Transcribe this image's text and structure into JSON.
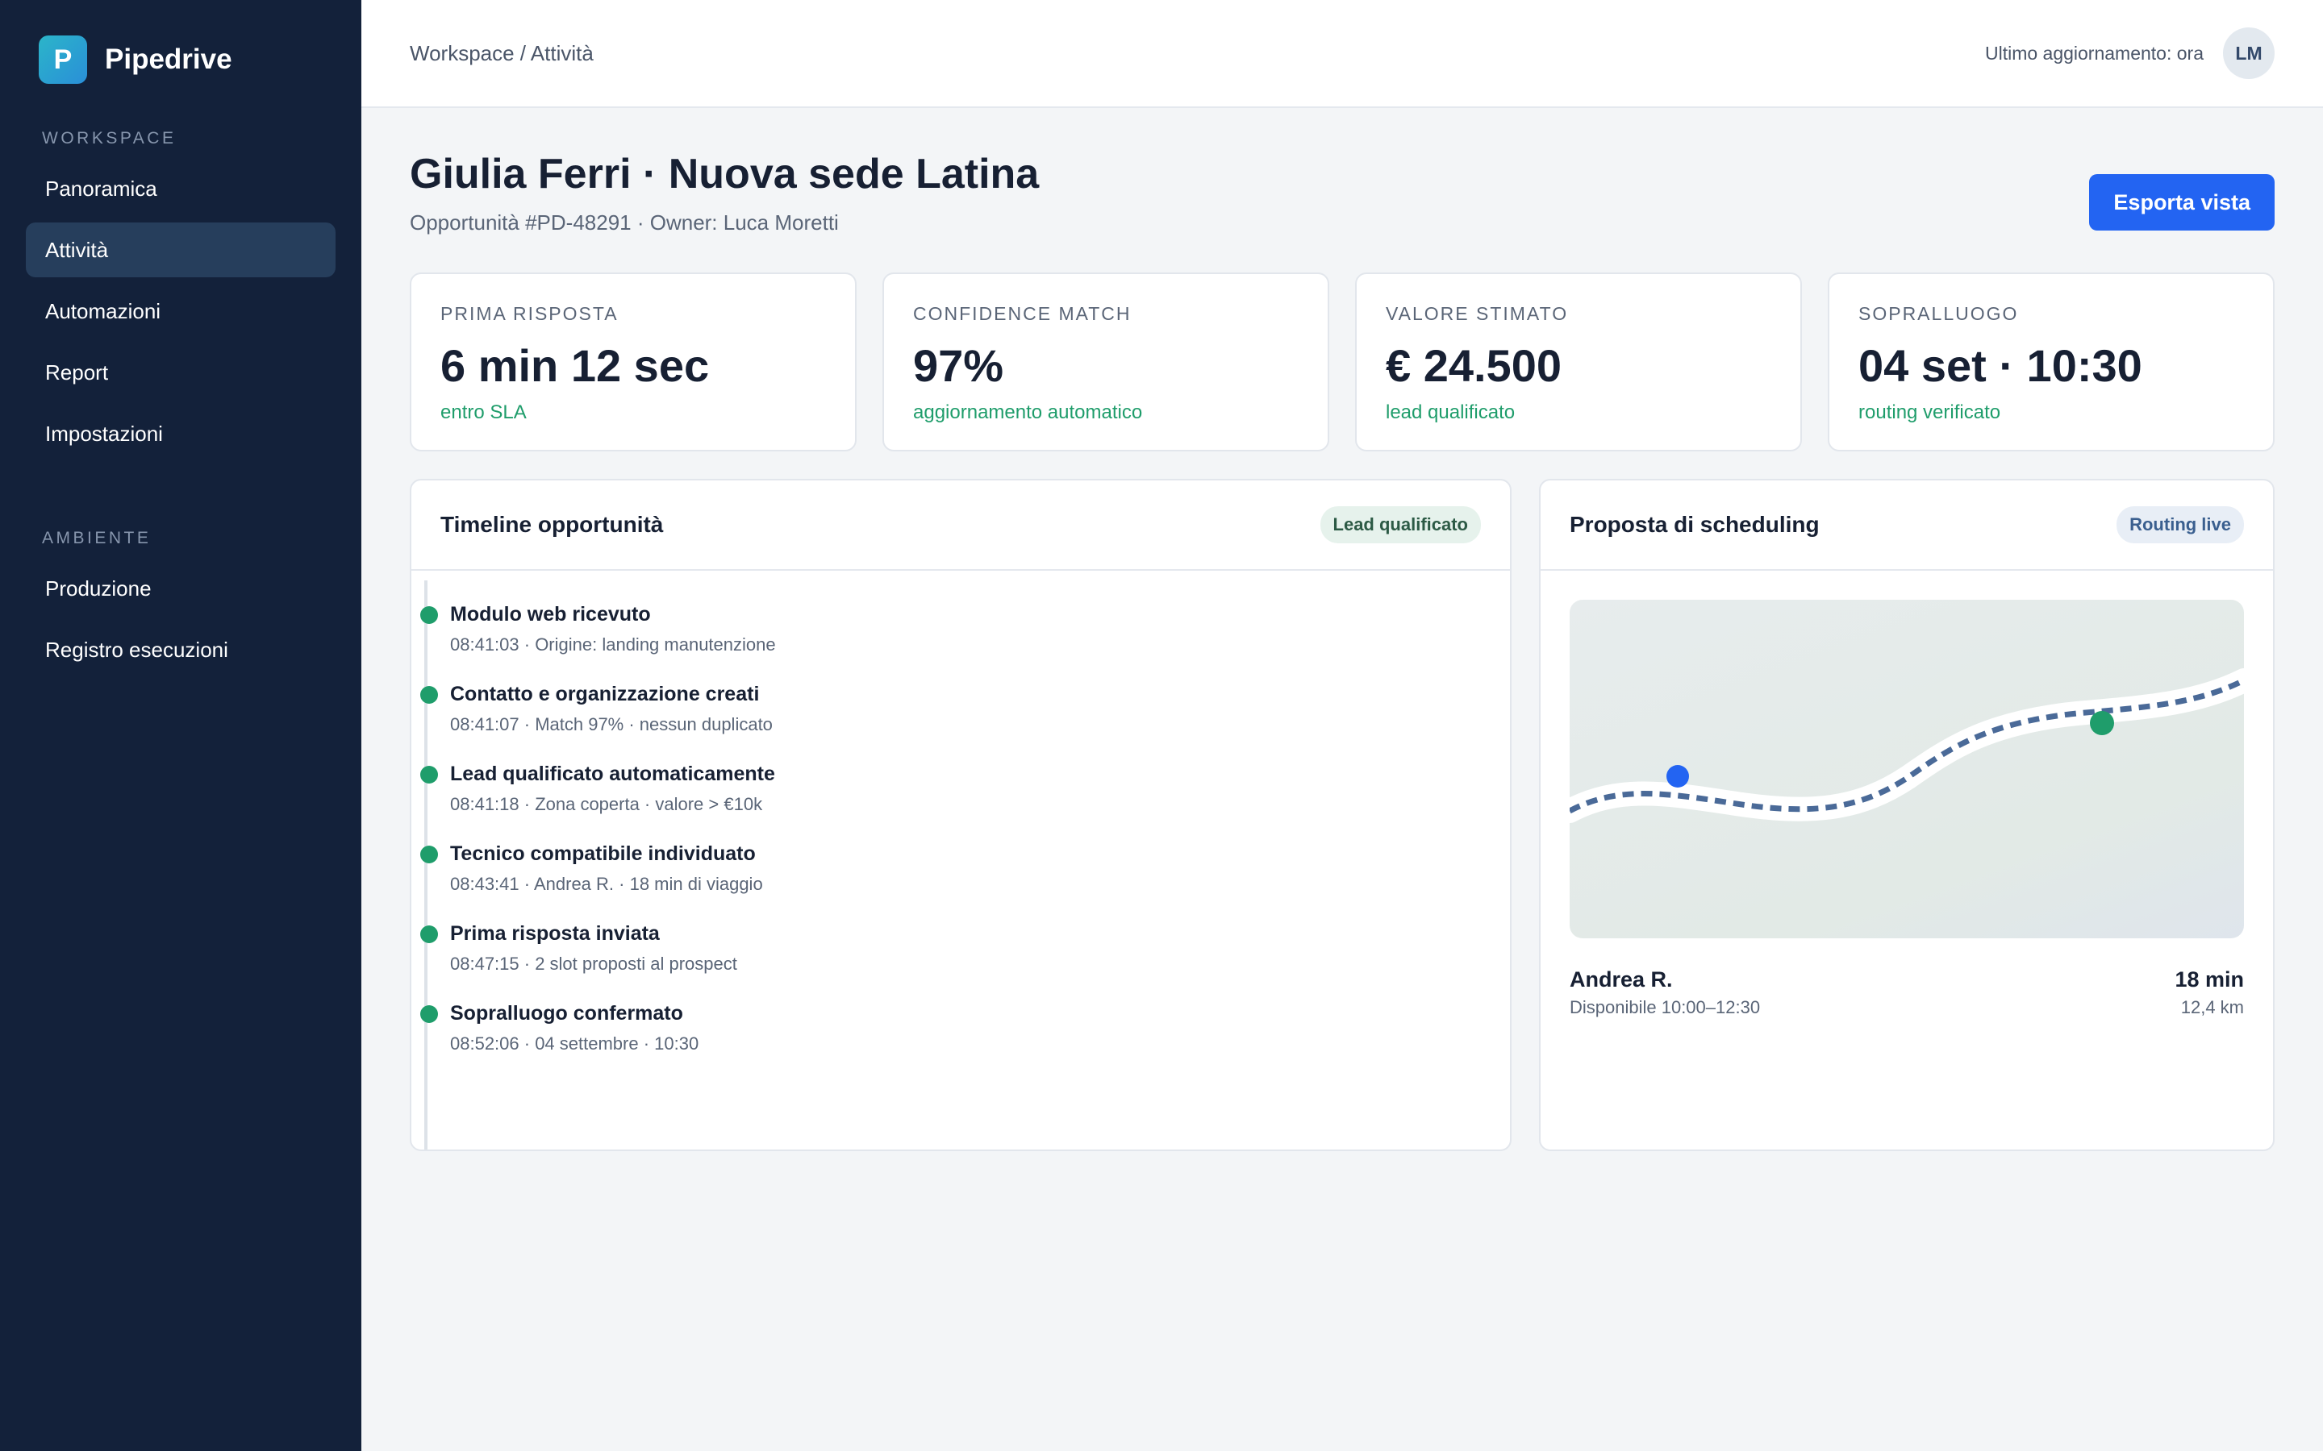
{
  "brand": {
    "logo_letter": "P",
    "name": "Pipedrive"
  },
  "sidebar": {
    "section_workspace": "WORKSPACE",
    "workspace_items": [
      {
        "label": "Panoramica"
      },
      {
        "label": "Attività",
        "active": true
      },
      {
        "label": "Automazioni"
      },
      {
        "label": "Report"
      },
      {
        "label": "Impostazioni"
      }
    ],
    "section_env": "AMBIENTE",
    "env_items": [
      {
        "label": "Produzione"
      },
      {
        "label": "Registro esecuzioni"
      }
    ]
  },
  "topbar": {
    "breadcrumb": "Workspace / Attività",
    "updated": "Ultimo aggiornamento: ora",
    "avatar": "LM"
  },
  "header": {
    "title": "Giulia Ferri · Nuova sede Latina",
    "subtitle": "Opportunità #PD-48291 · Owner: Luca Moretti",
    "export_label": "Esporta vista"
  },
  "kpis": [
    {
      "label": "PRIMA RISPOSTA",
      "value": "6 min 12 sec",
      "note": "entro SLA"
    },
    {
      "label": "CONFIDENCE MATCH",
      "value": "97%",
      "note": "aggiornamento automatico"
    },
    {
      "label": "VALORE STIMATO",
      "value": "€ 24.500",
      "note": "lead qualificato"
    },
    {
      "label": "SOPRALLUOGO",
      "value": "04 set · 10:30",
      "note": "routing verificato"
    }
  ],
  "timeline": {
    "title": "Timeline opportunità",
    "badge": "Lead qualificato",
    "items": [
      {
        "title": "Modulo web ricevuto",
        "meta": "08:41:03 · Origine: landing manutenzione"
      },
      {
        "title": "Contatto e organizzazione creati",
        "meta": "08:41:07 · Match 97% · nessun duplicato"
      },
      {
        "title": "Lead qualificato automaticamente",
        "meta": "08:41:18 · Zona coperta · valore > €10k"
      },
      {
        "title": "Tecnico compatibile individuato",
        "meta": "08:43:41 · Andrea R. · 18 min di viaggio"
      },
      {
        "title": "Prima risposta inviata",
        "meta": "08:47:15 · 2 slot proposti al prospect"
      },
      {
        "title": "Sopralluogo confermato",
        "meta": "08:52:06 · 04 settembre · 10:30"
      }
    ]
  },
  "scheduling": {
    "title": "Proposta di scheduling",
    "badge": "Routing live",
    "tech_name": "Andrea R.",
    "tech_availability": "Disponibile 10:00–12:30",
    "travel_time": "18 min",
    "distance": "12,4 km"
  },
  "colors": {
    "sidebar_bg": "#13213a",
    "accent": "#2364f2",
    "success": "#1f9d6b",
    "route": "#4a6a98"
  }
}
